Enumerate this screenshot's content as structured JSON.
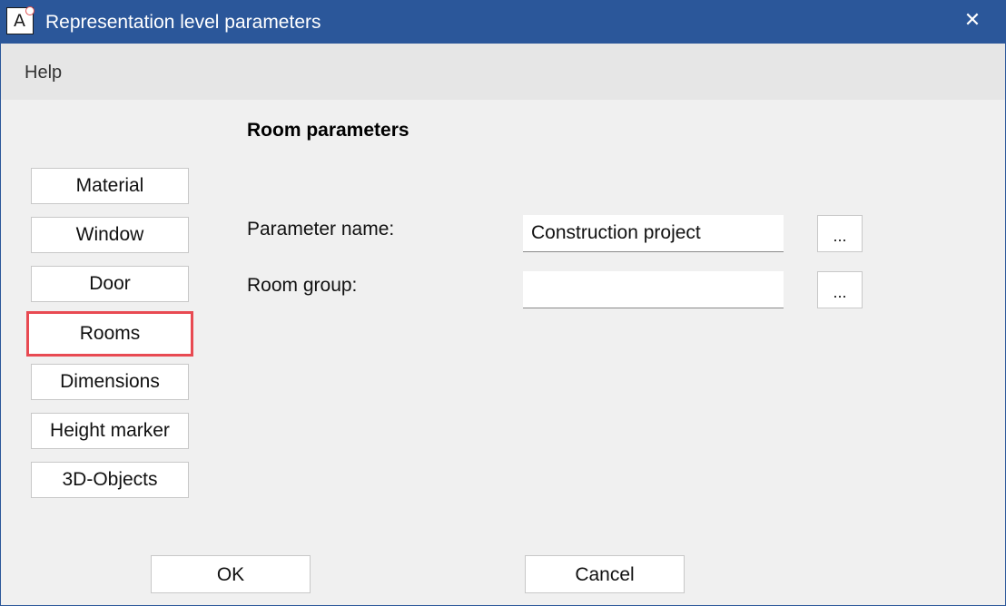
{
  "window": {
    "title": "Representation level parameters",
    "app_icon_letter": "A",
    "close_glyph": "✕",
    "accent_color": "#2b579a"
  },
  "menu": {
    "items": [
      {
        "label": "Help"
      }
    ]
  },
  "section": {
    "title": "Room parameters"
  },
  "nav": {
    "selected": "Rooms",
    "highlight_color": "#e84a52",
    "items": [
      {
        "label": "Material"
      },
      {
        "label": "Window"
      },
      {
        "label": "Door"
      },
      {
        "label": "Rooms"
      },
      {
        "label": "Dimensions"
      },
      {
        "label": "Height marker"
      },
      {
        "label": "3D-Objects"
      }
    ]
  },
  "fields": [
    {
      "label": "Parameter name:",
      "value": "Construction project",
      "browse_label": "..."
    },
    {
      "label": "Room group:",
      "value": "",
      "browse_label": "..."
    }
  ],
  "footer": {
    "ok_label": "OK",
    "cancel_label": "Cancel"
  }
}
